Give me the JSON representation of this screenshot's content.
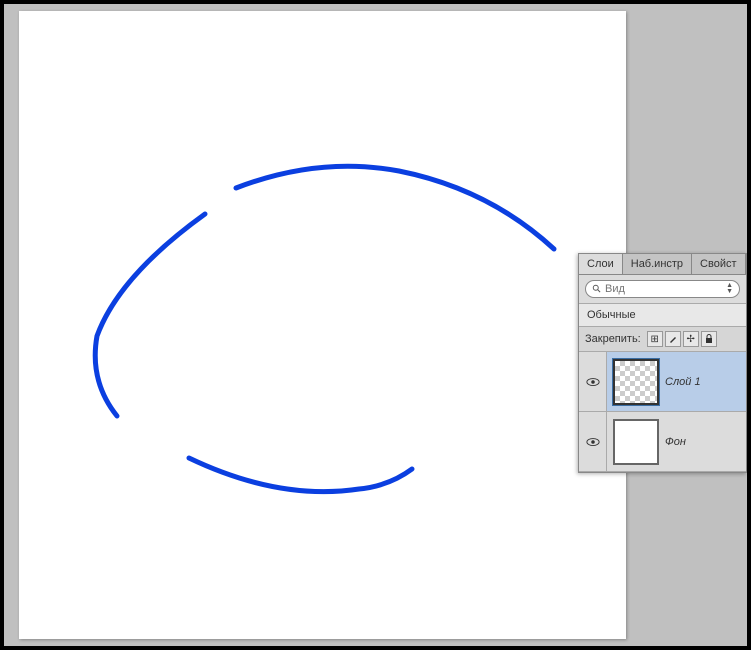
{
  "panel": {
    "tabs": [
      {
        "label": "Слои",
        "active": true
      },
      {
        "label": "Наб.инстр",
        "active": false
      },
      {
        "label": "Свойст",
        "active": false
      }
    ],
    "search": {
      "placeholder": "Вид"
    },
    "filter": "Обычные",
    "lock": {
      "label": "Закрепить:"
    },
    "layers": [
      {
        "name": "Слой 1",
        "selected": true,
        "transparent": true,
        "visible": true
      },
      {
        "name": "Фон",
        "selected": false,
        "transparent": false,
        "visible": true
      }
    ]
  },
  "canvas": {
    "stroke_color": "#0b3fe0",
    "stroke_width": 5
  }
}
